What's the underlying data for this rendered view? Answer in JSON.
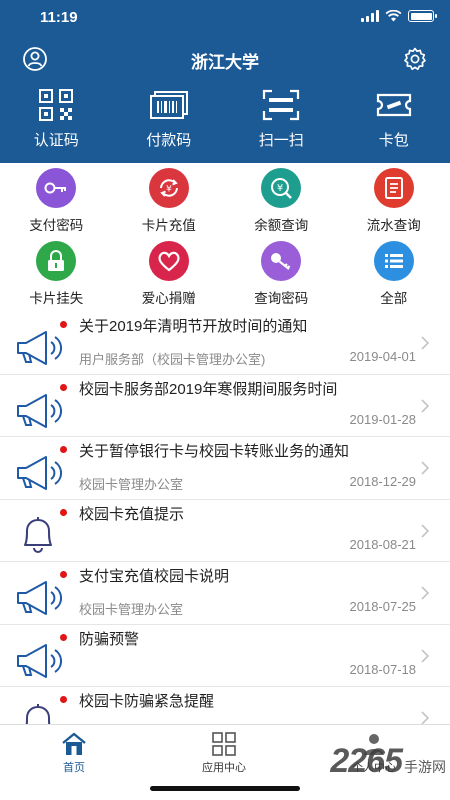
{
  "status": {
    "time": "11:19"
  },
  "header": {
    "title": "浙江大学",
    "left_icon": "user-icon",
    "right_icon": "gear-icon",
    "background": "#1c5a96"
  },
  "quick_actions": [
    {
      "label": "认证码",
      "icon": "qr-code-icon"
    },
    {
      "label": "付款码",
      "icon": "barcode-icon"
    },
    {
      "label": "扫一扫",
      "icon": "scan-icon"
    },
    {
      "label": "卡包",
      "icon": "ticket-icon"
    }
  ],
  "services": [
    {
      "label": "支付密码",
      "icon": "key-icon",
      "color": "#8a55d6"
    },
    {
      "label": "卡片充值",
      "icon": "recharge-icon",
      "color": "#d9363e"
    },
    {
      "label": "余额查询",
      "icon": "yuan-icon",
      "color": "#1e9e8f"
    },
    {
      "label": "流水查询",
      "icon": "document-icon",
      "color": "#e03b2f"
    },
    {
      "label": "卡片挂失",
      "icon": "lock-icon",
      "color": "#2fa84a"
    },
    {
      "label": "爱心捐赠",
      "icon": "heart-icon",
      "color": "#d8254b"
    },
    {
      "label": "查询密码",
      "icon": "key-icon",
      "color": "#9a5fd8"
    },
    {
      "label": "全部",
      "icon": "list-icon",
      "color": "#2c8fe0"
    }
  ],
  "notices": [
    {
      "title": "关于2019年清明节开放时间的通知",
      "source": "用户服务部（校园卡管理办公室)",
      "date": "2019-04-01",
      "icon": "megaphone-icon"
    },
    {
      "title": "校园卡服务部2019年寒假期间服务时间",
      "source": "",
      "date": "2019-01-28",
      "icon": "megaphone-icon"
    },
    {
      "title": "关于暂停银行卡与校园卡转账业务的通知",
      "source": "校园卡管理办公室",
      "date": "2018-12-29",
      "icon": "megaphone-icon"
    },
    {
      "title": "校园卡充值提示",
      "source": "",
      "date": "2018-08-21",
      "icon": "bell-icon"
    },
    {
      "title": "支付宝充值校园卡说明",
      "source": "校园卡管理办公室",
      "date": "2018-07-25",
      "icon": "megaphone-icon"
    },
    {
      "title": "防骗预警",
      "source": "",
      "date": "2018-07-18",
      "icon": "megaphone-icon"
    },
    {
      "title": "校园卡防骗紧急提醒",
      "source": "",
      "date": "",
      "icon": "bell-icon"
    }
  ],
  "tabs": [
    {
      "label": "首页",
      "icon": "home-icon",
      "active": true
    },
    {
      "label": "应用中心",
      "icon": "grid-icon",
      "active": false
    },
    {
      "label": "个人中心",
      "icon": "person-icon",
      "active": false
    }
  ],
  "watermark": {
    "number": "2265",
    "text": "手游网"
  },
  "colors": {
    "accent": "#1c5a96",
    "dot": "#e01515",
    "icon_line": "#1e5aa8"
  }
}
